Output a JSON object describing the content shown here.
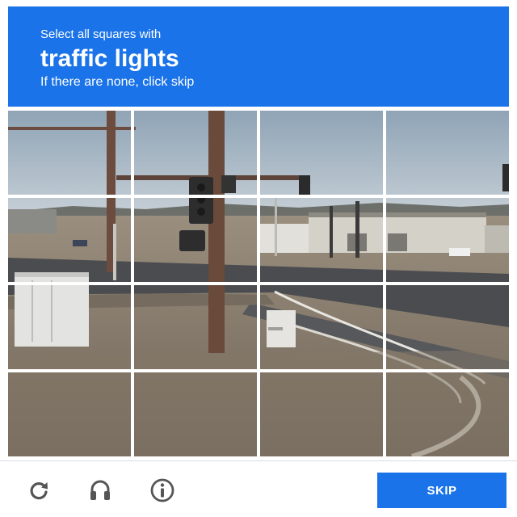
{
  "header": {
    "line1": "Select all squares with",
    "target": "traffic lights",
    "line3": "If there are none, click skip"
  },
  "grid": {
    "rows": 4,
    "columns": 4,
    "tiles": 16
  },
  "footer": {
    "reload_icon": "reload-icon",
    "audio_icon": "headphones-icon",
    "info_icon": "info-icon",
    "skip_label": "SKIP"
  },
  "colors": {
    "accent": "#1a73e8",
    "background": "#ffffff",
    "icon": "#555555"
  }
}
